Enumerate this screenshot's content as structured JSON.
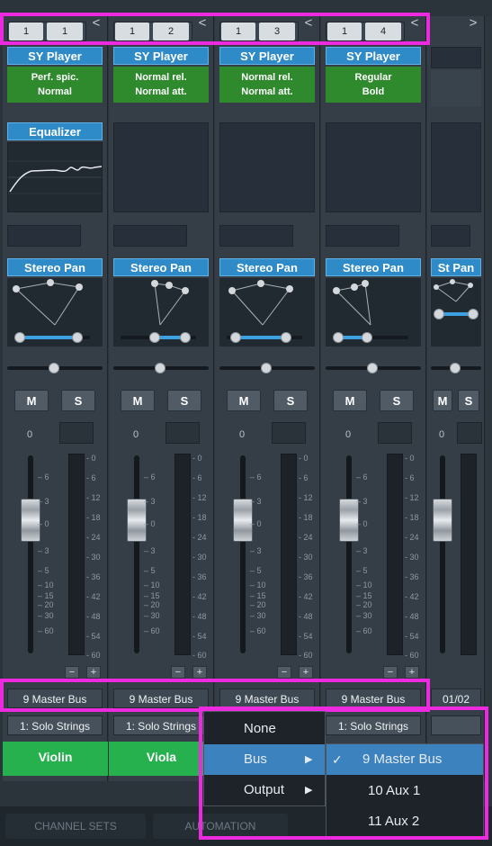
{
  "channels": [
    {
      "routing": [
        "1",
        "1"
      ],
      "player": "SY Player",
      "articulation_line1": "Perf. spic.",
      "articulation_line2": "Normal",
      "insert_plugin": "Equalizer",
      "pan_plugin": "Stereo Pan",
      "mute": "M",
      "solo": "S",
      "volume": "0",
      "output_bus": "9 Master Bus",
      "source": "1: Solo Strings",
      "name": "Violin"
    },
    {
      "routing": [
        "1",
        "2"
      ],
      "player": "SY Player",
      "articulation_line1": "Normal rel.",
      "articulation_line2": "Normal att.",
      "pan_plugin": "Stereo Pan",
      "mute": "M",
      "solo": "S",
      "volume": "0",
      "output_bus": "9 Master Bus",
      "source": "1: Solo Strings",
      "name": "Viola"
    },
    {
      "routing": [
        "1",
        "3"
      ],
      "player": "SY Player",
      "articulation_line1": "Normal rel.",
      "articulation_line2": "Normal att.",
      "pan_plugin": "Stereo Pan",
      "mute": "M",
      "solo": "S",
      "volume": "0",
      "output_bus": "9 Master Bus"
    },
    {
      "routing": [
        "1",
        "4"
      ],
      "player": "SY Player",
      "articulation_line1": "Regular",
      "articulation_line2": "Bold",
      "pan_plugin": "Stereo Pan",
      "mute": "M",
      "solo": "S",
      "volume": "0",
      "output_bus": "9 Master Bus",
      "source": "1: Solo Strings"
    },
    {
      "pan_plugin": "St Pan",
      "mute": "M",
      "solo": "S",
      "volume": "0",
      "output_bus": "01/02"
    }
  ],
  "fader_scale": [
    "6",
    "3",
    "0",
    "3",
    "5",
    "10",
    "15",
    "20",
    "30",
    "60"
  ],
  "meter_scale": [
    "0",
    "6",
    "12",
    "18",
    "24",
    "30",
    "36",
    "42",
    "48",
    "54",
    "60"
  ],
  "meter_plus": "+",
  "meter_minus": "−",
  "scroll_left_arrow": "<",
  "scroll_right_arrow": ">",
  "context_menu": {
    "items": [
      "None",
      "Bus",
      "Output"
    ],
    "selected": "Bus",
    "submenu": [
      {
        "label": "9  Master Bus",
        "checked": true
      },
      {
        "label": "10  Aux 1",
        "checked": false
      },
      {
        "label": "11  Aux 2",
        "checked": false
      }
    ],
    "check_mark": "✓",
    "submenu_arrow": "▶"
  },
  "bottom_tabs": [
    "CHANNEL SETS",
    "AUTOMATION"
  ],
  "colors": {
    "highlight": "#ee2ae0",
    "plugin_blue": "#2f8ac8",
    "articulation_green": "#2f8a2e",
    "name_green": "#26b14e",
    "menu_selected": "#3b82bf"
  }
}
